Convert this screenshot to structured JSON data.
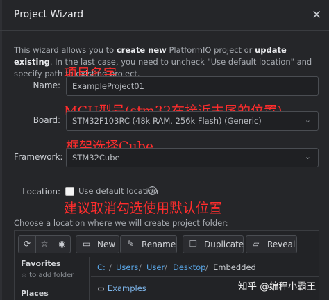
{
  "dialog": {
    "title": "Project Wizard",
    "close_glyph": "✕",
    "description_parts": [
      "This wizard allows you to ",
      "create new",
      " PlatformIO project or ",
      "update existing",
      ". In the last case, you need to uncheck \"Use default location\" and specify path to existing project."
    ]
  },
  "form": {
    "name_label": "Name:",
    "name_value": "ExampleProject01",
    "board_label": "Board:",
    "board_value": "STM32F103RC (48k RAM. 256k Flash) (Generic)",
    "framework_label": "Framework:",
    "framework_value": "STM32Cube",
    "location_label": "Location:",
    "use_default_label": "Use default location",
    "use_default_checked": false,
    "help_glyph": "?",
    "chevron_glyph": "⌄",
    "choose_text": "Choose a location where we will create project folder:"
  },
  "annotations": {
    "name": "项目名字",
    "board": "MCU型号(stm32在接近末尾的位置)",
    "framework": "框架选择Cube",
    "location": "建议取消勾选使用默认位置"
  },
  "browser": {
    "toolbar": {
      "refresh_glyph": "⟳",
      "star_glyph": "☆",
      "eye_glyph": "◉",
      "new_label": "New",
      "new_glyph": "▭",
      "rename_label": "Rename",
      "rename_glyph": "✎",
      "duplicate_label": "Duplicate",
      "duplicate_glyph": "❐",
      "reveal_label": "Reveal",
      "reveal_glyph": "▱"
    },
    "sidebar": {
      "favorites_title": "Favorites",
      "favorites_hint": "☆ to add folder",
      "places_title": "Places"
    },
    "path": {
      "drive": "C:",
      "sep": "/",
      "users": "Users",
      "user": "User",
      "desktop": "Desktop",
      "current": "Embedded"
    },
    "files": [
      {
        "name": "Examples",
        "glyph": "▭"
      }
    ]
  },
  "watermark": "知乎 @编程小霸王"
}
